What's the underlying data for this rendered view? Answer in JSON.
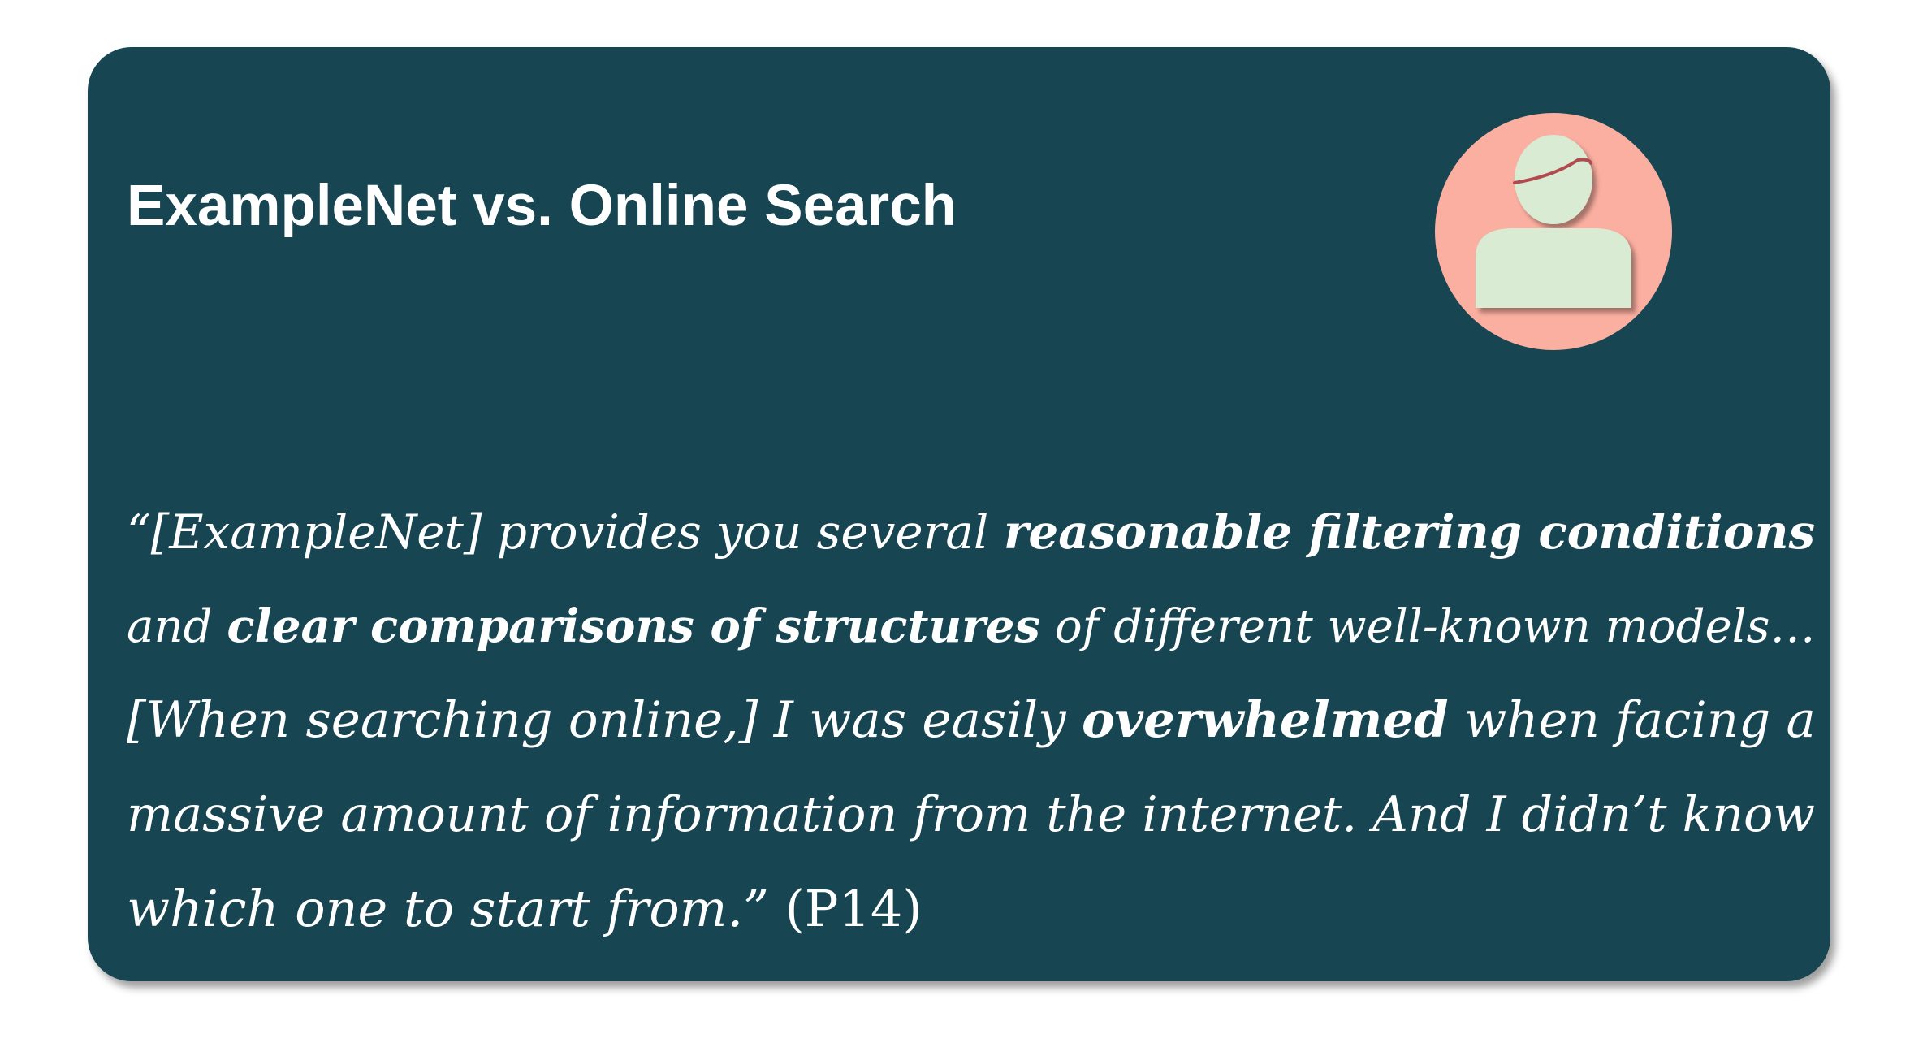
{
  "card": {
    "title": "ExampleNet vs. Online Search",
    "avatar_icon": "user-avatar-icon",
    "colors": {
      "card_background": "#174551",
      "avatar_circle": "#fbafa0",
      "avatar_figure": "#d9ebd3",
      "text": "#ffffff"
    }
  },
  "quote": {
    "line1": {
      "t1": "“[ExampleNet] provides you several ",
      "b1": "reasonable filtering conditions"
    },
    "line2": {
      "t1": "and ",
      "b1": "clear comparisons of structures",
      "t2": " of different well-known models…"
    },
    "line3": {
      "t1": "[When searching online,] I was easily ",
      "b1": "overwhelmed",
      "t2": " when facing a"
    },
    "line4": {
      "t1": "massive amount of information from the internet. And I didn’t know"
    },
    "line5": {
      "t1": "which one to start from.”",
      "attribution": " (P14)"
    }
  }
}
